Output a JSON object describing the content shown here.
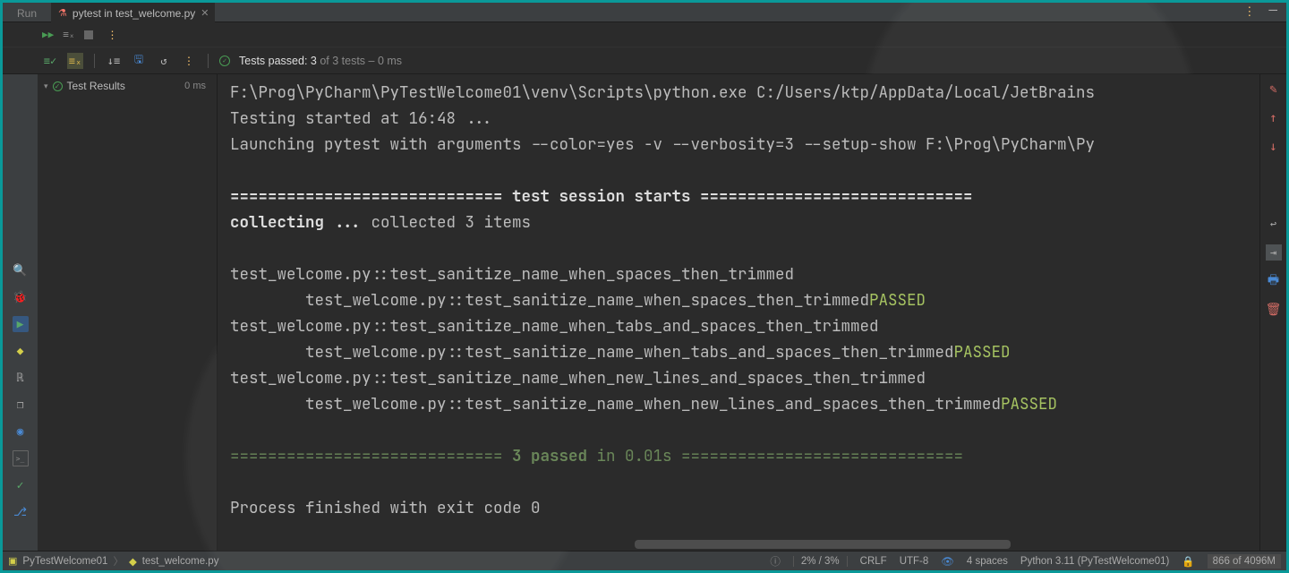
{
  "tabStrip": {
    "runLabel": "Run",
    "tab": {
      "title": "pytest in test_welcome.py"
    }
  },
  "toolbar2Summary": {
    "prefix": "Tests passed: ",
    "count": "3",
    "ofText": " of 3 tests",
    "dash": " – ",
    "time": "0 ms"
  },
  "tree": {
    "root": "Test Results",
    "rootTime": "0 ms"
  },
  "console": {
    "line1": "F:\\Prog\\PyCharm\\PyTestWelcome01\\venv\\Scripts\\python.exe C:/Users/ktp/AppData/Local/JetBrains",
    "line2": "Testing started at 16:48 ...",
    "line3": "Launching pytest with arguments --color=yes -v --verbosity=3 --setup-show F:\\Prog\\PyCharm\\Py",
    "sess_eq1": "============================= ",
    "sess_title": "test session starts",
    "sess_eq2": " =============================",
    "collecting": "collecting ... ",
    "collected": "collected 3 items",
    "t1a": "test_welcome.py::test_sanitize_name_when_spaces_then_trimmed",
    "t1b_pre": "        test_welcome.py::test_sanitize_name_when_spaces_then_trimmed",
    "t2a": "test_welcome.py::test_sanitize_name_when_tabs_and_spaces_then_trimmed",
    "t2b_pre": "        test_welcome.py::test_sanitize_name_when_tabs_and_spaces_then_trimmed",
    "t3a": "test_welcome.py::test_sanitize_name_when_new_lines_and_spaces_then_trimmed",
    "t3b_pre": "        test_welcome.py::test_sanitize_name_when_new_lines_and_spaces_then_trimmed",
    "passed": "PASSED",
    "sum_eq1": "============================= ",
    "sum_count": "3 passed",
    "sum_time": " in 0.01s",
    "sum_eq2": " ==============================",
    "proc": "Process finished with exit code 0"
  },
  "status": {
    "project": "PyTestWelcome01",
    "file": "test_welcome.py",
    "pct": "2% /    3%",
    "eol": "CRLF",
    "enc": "UTF-8",
    "indent": "4 spaces",
    "interp": "Python 3.11 (PyTestWelcome01)",
    "mem": "866 of 4096M"
  }
}
